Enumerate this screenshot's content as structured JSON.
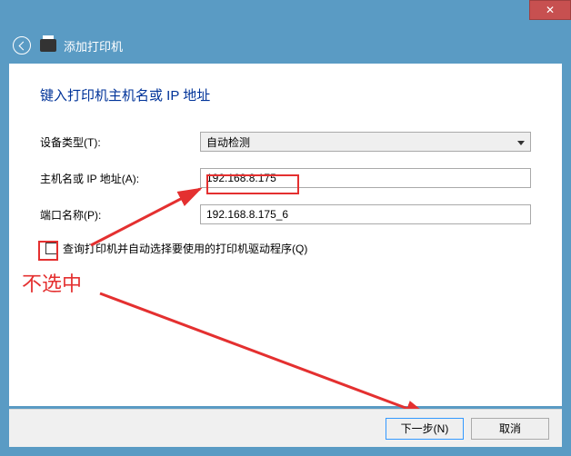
{
  "window": {
    "title": "添加打印机"
  },
  "page": {
    "heading": "键入打印机主机名或 IP 地址"
  },
  "form": {
    "device_type_label": "设备类型(T):",
    "device_type_value": "自动检测",
    "hostname_label": "主机名或 IP 地址(A):",
    "hostname_value": "192.168.8.175",
    "port_label": "端口名称(P):",
    "port_value": "192.168.8.175_6",
    "query_label": "查询打印机并自动选择要使用的打印机驱动程序(Q)"
  },
  "annotation": {
    "not_selected": "不选中"
  },
  "footer": {
    "next": "下一步(N)",
    "cancel": "取消"
  }
}
